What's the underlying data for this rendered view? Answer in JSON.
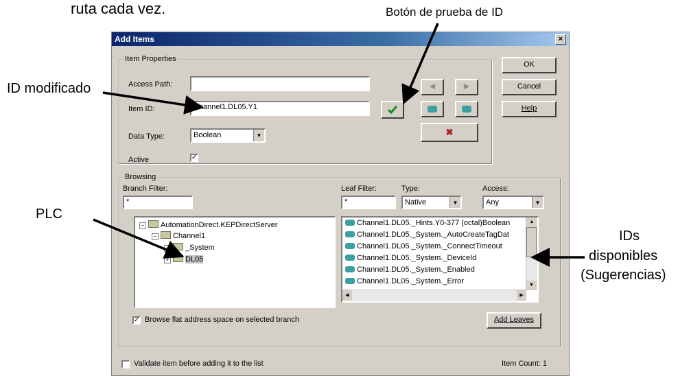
{
  "annotations": {
    "top_text": "ruta cada vez.",
    "test_button": "Botón de prueba de ID",
    "modified_id": "ID modificado",
    "plc": "PLC",
    "ids_line1": "IDs",
    "ids_line2": "disponibles",
    "ids_line3": "(Sugerencias)"
  },
  "dialog": {
    "title": "Add Items",
    "close": "×",
    "item_properties": {
      "legend": "Item Properties",
      "access_path_label": "Access Path:",
      "access_path_value": "",
      "item_id_label": "Item ID:",
      "item_id_value": "Channel1.DL05.Y1",
      "data_type_label": "Data Type:",
      "data_type_value": "Boolean",
      "active_label": "Active",
      "active_checked": "✓"
    },
    "buttons": {
      "ok": "OK",
      "cancel": "Cancel",
      "help": "Help",
      "add_leaves": "Add Leaves"
    },
    "browsing": {
      "legend": "Browsing",
      "branch_filter_label": "Branch Filter:",
      "branch_filter_value": "*",
      "leaf_filter_label": "Leaf Filter:",
      "leaf_filter_value": "*",
      "type_label": "Type:",
      "type_value": "Native",
      "access_label": "Access:",
      "access_value": "Any",
      "tree": [
        "AutomationDirect.KEPDirectServer",
        "Channel1",
        "_System",
        "DL05"
      ],
      "leaves": [
        "Channel1.DL05._Hints.Y0-377 (octal)Boolean",
        "Channel1.DL05._System._AutoCreateTagDat",
        "Channel1.DL05._System._ConnectTimeout",
        "Channel1.DL05._System._DeviceId",
        "Channel1.DL05._System._Enabled",
        "Channel1.DL05._System._Error"
      ],
      "browse_flat_label": "Browse flat address space on selected branch",
      "browse_flat_checked": "✓"
    },
    "validate_label": "Validate item before adding it to the list",
    "item_count": "Item Count: 1"
  }
}
